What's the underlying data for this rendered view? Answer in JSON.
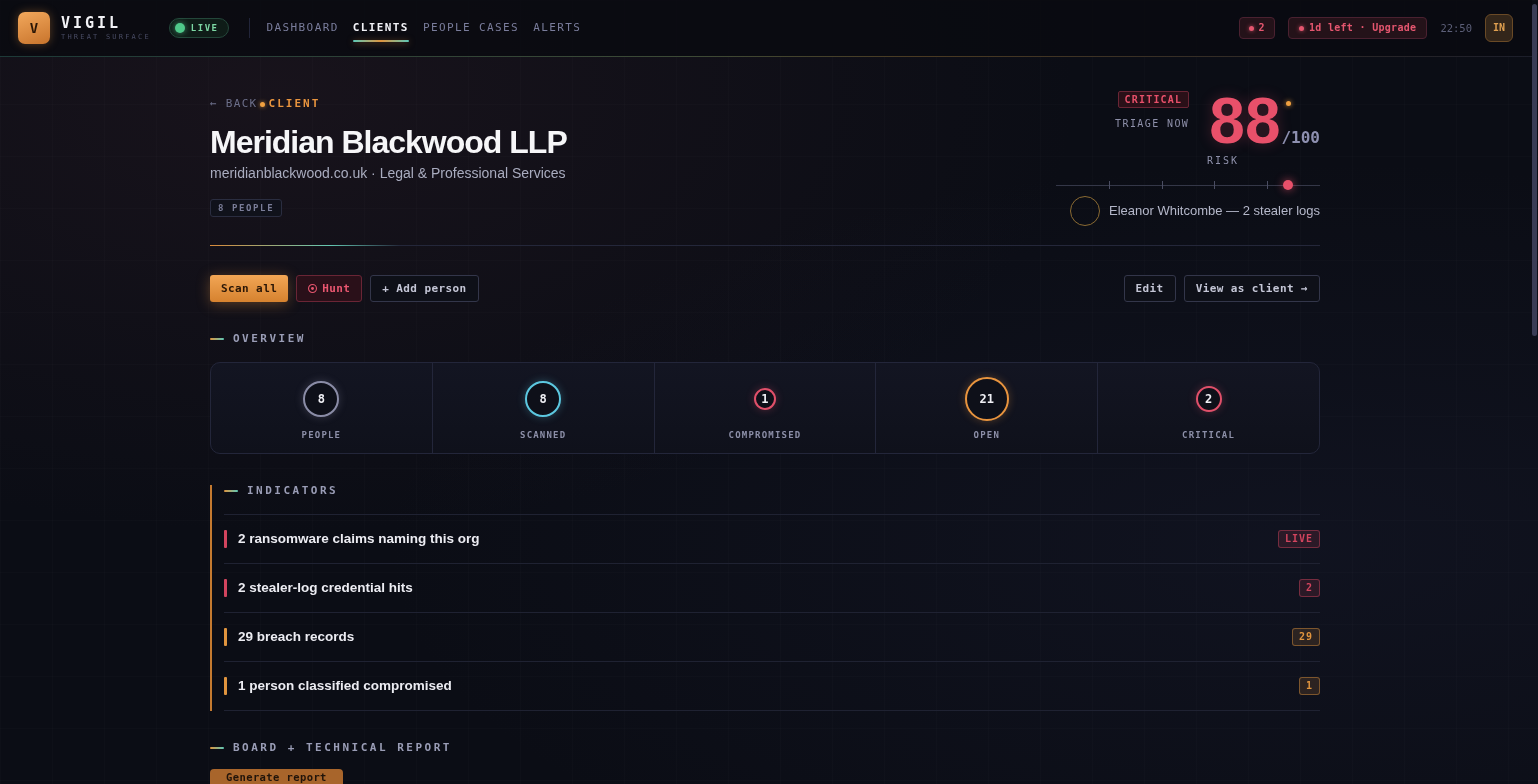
{
  "brand": {
    "logo": "V",
    "name": "VIGIL",
    "tagline": "THREAT SURFACE"
  },
  "live_badge": {
    "label": "LIVE",
    "on": true
  },
  "nav": [
    {
      "label": "DASHBOARD",
      "selected": false
    },
    {
      "label": "CLIENTS",
      "selected": true
    },
    {
      "label": "PEOPLE CASES",
      "selected": false
    },
    {
      "label": "ALERTS",
      "selected": false
    }
  ],
  "topbar": {
    "alerts": "2",
    "trial": "1d left · Upgrade",
    "time": "22:50",
    "avatar": "IN"
  },
  "client": {
    "back": "← BACK",
    "eyebrow": "CLIENT",
    "name": "Meridian Blackwood LLP",
    "subtitle": "meridianblackwood.co.uk · Legal & Professional Services",
    "people_tag": "8 PEOPLE"
  },
  "risk": {
    "severity": "CRITICAL",
    "action": "TRIAGE NOW",
    "score": "88",
    "max": "/100",
    "label": "RISK",
    "level": 0.88,
    "top_person": "Eleanor Whitcombe — 2 stealer logs"
  },
  "actions_left": [
    {
      "label": "Scan all",
      "kind": "primary"
    },
    {
      "label": "Hunt",
      "kind": "danger"
    },
    {
      "label": "+ Add person",
      "kind": "outline"
    }
  ],
  "actions_right": [
    {
      "label": "Edit",
      "kind": "outline"
    },
    {
      "label": "View as client →",
      "kind": "outline"
    }
  ],
  "overview": {
    "title": "OVERVIEW",
    "stats": [
      {
        "value": "8",
        "label": "PEOPLE",
        "color": "#8a8ca6"
      },
      {
        "value": "8",
        "label": "SCANNED",
        "color": "#5cc8e0"
      },
      {
        "value": "1",
        "label": "COMPROMISED",
        "color": "#e0506a"
      },
      {
        "value": "21",
        "label": "OPEN",
        "color": "#e8943e"
      },
      {
        "value": "2",
        "label": "CRITICAL",
        "color": "#e0506a"
      }
    ]
  },
  "indicators": {
    "title": "INDICATORS",
    "items": [
      {
        "text": "2 ransomware claims naming this org",
        "tag": "LIVE",
        "color": "#d2445e"
      },
      {
        "text": "2 stealer-log credential hits",
        "tag": "2",
        "color": "#d2445e"
      },
      {
        "text": "29 breach records",
        "tag": "29",
        "color": "#e0943e"
      },
      {
        "text": "1 person classified compromised",
        "tag": "1",
        "color": "#e0943e"
      }
    ]
  },
  "report": {
    "title": "BOARD + TECHNICAL REPORT",
    "button": "Generate report"
  }
}
